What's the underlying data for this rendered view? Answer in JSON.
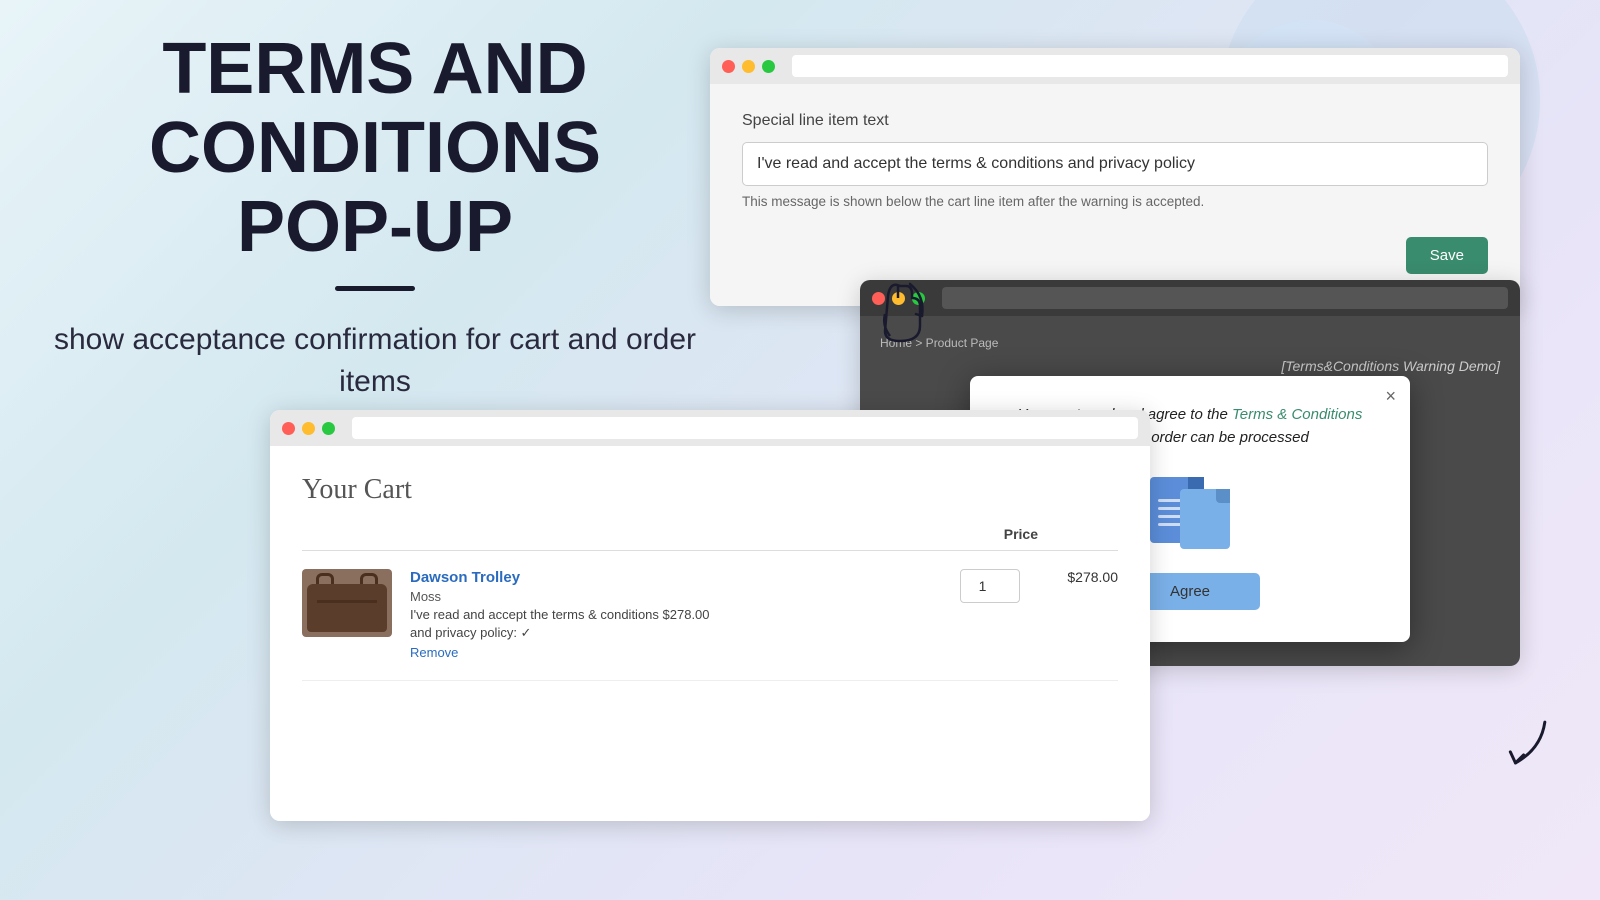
{
  "page": {
    "background": "gradient"
  },
  "left_panel": {
    "title_line1": "TERMS AND",
    "title_line2": "CONDITIONS",
    "title_line3": "POP-UP",
    "subtitle": "show acceptance confirmation for cart and order items"
  },
  "settings_window": {
    "titlebar": {
      "dots": [
        "red",
        "yellow",
        "green"
      ]
    },
    "form": {
      "label": "Special line item text",
      "input_value": "I've read and accept the terms & conditions and privacy policy",
      "hint": "This message is shown below the cart line item after the warning is accepted.",
      "save_button": "Save"
    }
  },
  "popup_window": {
    "titlebar": {
      "dots": [
        "red",
        "yellow",
        "green"
      ]
    },
    "breadcrumb": "Home > Product Page",
    "header_text": "[Terms&Conditions Warning Demo]",
    "modal": {
      "text_before_link": "You must read and agree to the ",
      "link_text": "Terms & Conditions",
      "text_after_link": " before your order can be processed",
      "agree_button": "Agree",
      "close_button": "×"
    }
  },
  "cart_window": {
    "titlebar": {
      "dots": [
        "red",
        "yellow",
        "green"
      ]
    },
    "cart_title": "Your Cart",
    "header": {
      "price_col": "Price"
    },
    "item": {
      "name": "Dawson Trolley",
      "variant": "Moss",
      "terms_text": "I've read and accept the terms & conditions",
      "terms_price": "  $278.00",
      "privacy_text": "and privacy policy: ✓",
      "remove_label": "Remove",
      "qty": "1",
      "subtotal": "$278.00"
    }
  },
  "icons": {
    "hand_cursor": "☞",
    "arrow_down": "↙"
  }
}
